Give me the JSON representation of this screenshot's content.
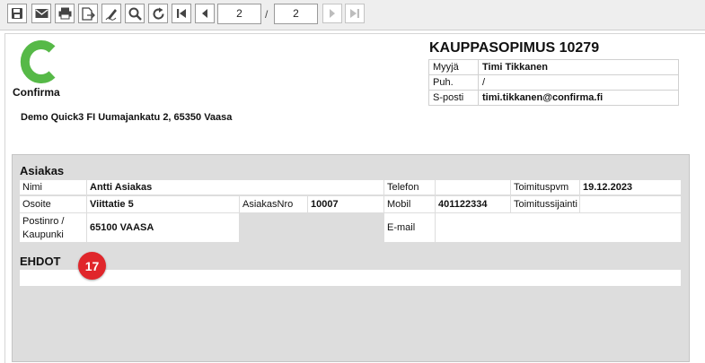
{
  "toolbar": {
    "current_page": "2",
    "page_separator": "/",
    "total_pages": "2",
    "icons": [
      "save-icon",
      "email-icon",
      "print-icon",
      "export-icon",
      "sign-icon",
      "search-icon",
      "refresh-icon",
      "first-page-icon",
      "previous-page-icon",
      "next-page-icon",
      "last-page-icon"
    ]
  },
  "document": {
    "title": "KAUPPASOPIMUS 10279",
    "logo_text": "Confirma",
    "logo_color": "#56b947",
    "address": "Demo Quick3 FI Uumajankatu 2, 65350 Vaasa",
    "seller": {
      "myyja_label": "Myyjä",
      "myyja_value": "Timi Tikkanen",
      "puh_label": "Puh.",
      "puh_value": "/",
      "sposti_label": "S-posti",
      "sposti_value": "timi.tikkanen@confirma.fi"
    }
  },
  "customer": {
    "section_title": "Asiakas",
    "nimi_label": "Nimi",
    "nimi_value": "Antti Asiakas",
    "telefon_label": "Telefon",
    "telefon_value": "",
    "toimituspvm_label": "Toimituspvm",
    "toimituspvm_value": "19.12.2023",
    "osoite_label": "Osoite",
    "osoite_value": "Viittatie 5",
    "asiakasnro_label": "AsiakasNro",
    "asiakasnro_value": "10007",
    "mobil_label": "Mobil",
    "mobil_value": "401122334",
    "toimitussijainti_label": "Toimitussijainti",
    "toimitussijainti_value": "",
    "postinro_label_1": "Postinro /",
    "postinro_label_2": "Kaupunki",
    "postinro_value": "65100 VAASA",
    "email_label": "E-mail",
    "email_value": ""
  },
  "ehdot": {
    "section_title": "EHDOT",
    "badge": "17",
    "badge_color": "#e0262b"
  }
}
